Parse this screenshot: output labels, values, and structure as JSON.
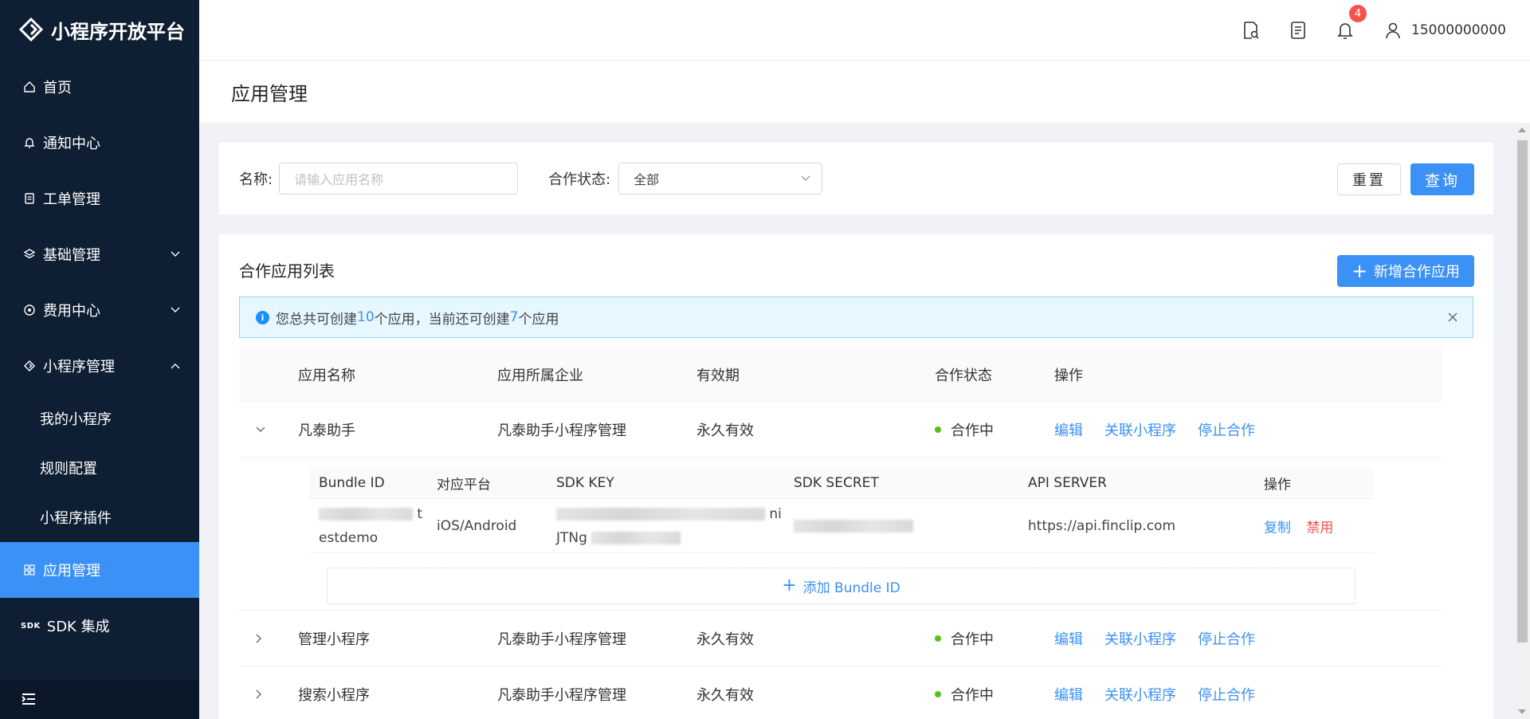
{
  "app": {
    "title": "小程序开放平台"
  },
  "sidebar": {
    "items": [
      {
        "label": "首页",
        "icon": "home-icon"
      },
      {
        "label": "通知中心",
        "icon": "bell-icon"
      },
      {
        "label": "工单管理",
        "icon": "ticket-icon"
      },
      {
        "label": "基础管理",
        "icon": "layers-icon"
      },
      {
        "label": "费用中心",
        "icon": "coin-icon"
      },
      {
        "label": "小程序管理",
        "icon": "diamond-icon"
      }
    ],
    "sub_items": [
      {
        "label": "我的小程序"
      },
      {
        "label": "规则配置"
      },
      {
        "label": "小程序插件"
      }
    ],
    "active_item": {
      "label": "应用管理",
      "icon": "grid-icon"
    },
    "sdk_item": {
      "tag": "SDK",
      "label": "SDK 集成"
    }
  },
  "header": {
    "notification_count": "4",
    "username": "15000000000"
  },
  "page": {
    "title": "应用管理"
  },
  "filter": {
    "name_label": "名称:",
    "name_placeholder": "请输入应用名称",
    "status_label": "合作状态:",
    "status_value": "全部",
    "reset_label": "重置",
    "query_label": "查询"
  },
  "list": {
    "title": "合作应用列表",
    "add_label": "新增合作应用",
    "alert": {
      "text_1": "您总共可创建",
      "total": "10",
      "text_2": "个应用，当前还可创建",
      "remaining": "7",
      "text_3": "个应用"
    },
    "columns": [
      "应用名称",
      "应用所属企业",
      "有效期",
      "合作状态",
      "操作"
    ],
    "rows": [
      {
        "name": "凡泰助手",
        "enterprise": "凡泰助手小程序管理",
        "validity": "永久有效",
        "status": "合作中",
        "actions": [
          "编辑",
          "关联小程序",
          "停止合作"
        ]
      },
      {
        "name": "管理小程序",
        "enterprise": "凡泰助手小程序管理",
        "validity": "永久有效",
        "status": "合作中",
        "actions": [
          "编辑",
          "关联小程序",
          "停止合作"
        ]
      },
      {
        "name": "搜索小程序",
        "enterprise": "凡泰助手小程序管理",
        "validity": "永久有效",
        "status": "合作中",
        "actions": [
          "编辑",
          "关联小程序",
          "停止合作"
        ]
      }
    ],
    "sub_table": {
      "columns": [
        "Bundle ID",
        "对应平台",
        "SDK KEY",
        "SDK SECRET",
        "API SERVER",
        "操作"
      ],
      "row": {
        "bundle_id_tail_1": "t",
        "bundle_id_tail_2": "estdemo",
        "platform": "iOS/Android",
        "sdk_key_tail_1": "ni",
        "sdk_key_tail_2": "JTNg",
        "api_server": "https://api.finclip.com",
        "action_copy": "复制",
        "action_disable": "禁用"
      },
      "add_label": "添加 Bundle ID"
    }
  },
  "colors": {
    "sidebar_bg": "#0e1f33",
    "accent": "#3b91f5",
    "danger": "#f5544e",
    "success": "#52c41a"
  }
}
